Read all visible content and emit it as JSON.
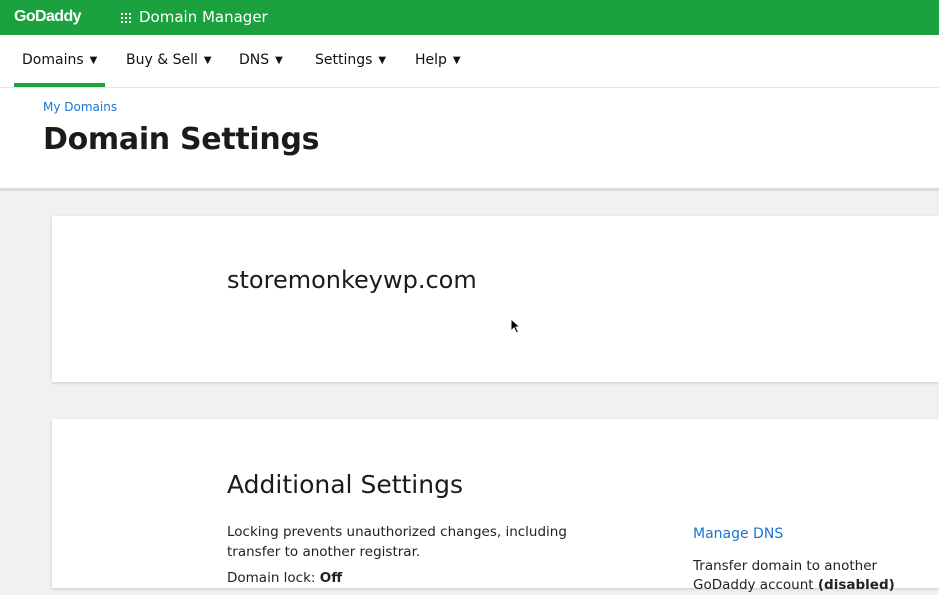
{
  "header": {
    "logo": "GoDaddy",
    "app_icon": "apps-grid-icon",
    "app_title": "Domain Manager"
  },
  "nav": {
    "items": [
      {
        "label": "Domains",
        "active": true
      },
      {
        "label": "Buy & Sell"
      },
      {
        "label": "DNS"
      },
      {
        "label": "Settings"
      },
      {
        "label": "Help"
      }
    ],
    "caret_icon": "caret-down-icon"
  },
  "page": {
    "breadcrumb": "My Domains",
    "title": "Domain Settings"
  },
  "domain_card": {
    "domain": "storemonkeywp.com"
  },
  "additional": {
    "title": "Additional Settings",
    "lock_description": "Locking prevents unauthorized changes, including transfer to another registrar.",
    "lock_label": "Domain lock: ",
    "lock_value": "Off",
    "manage_dns": "Manage DNS",
    "transfer_text": "Transfer domain to another GoDaddy account ",
    "transfer_state": "(disabled)"
  },
  "colors": {
    "brand_green": "#1ba23f",
    "link_blue": "#1976d2"
  }
}
